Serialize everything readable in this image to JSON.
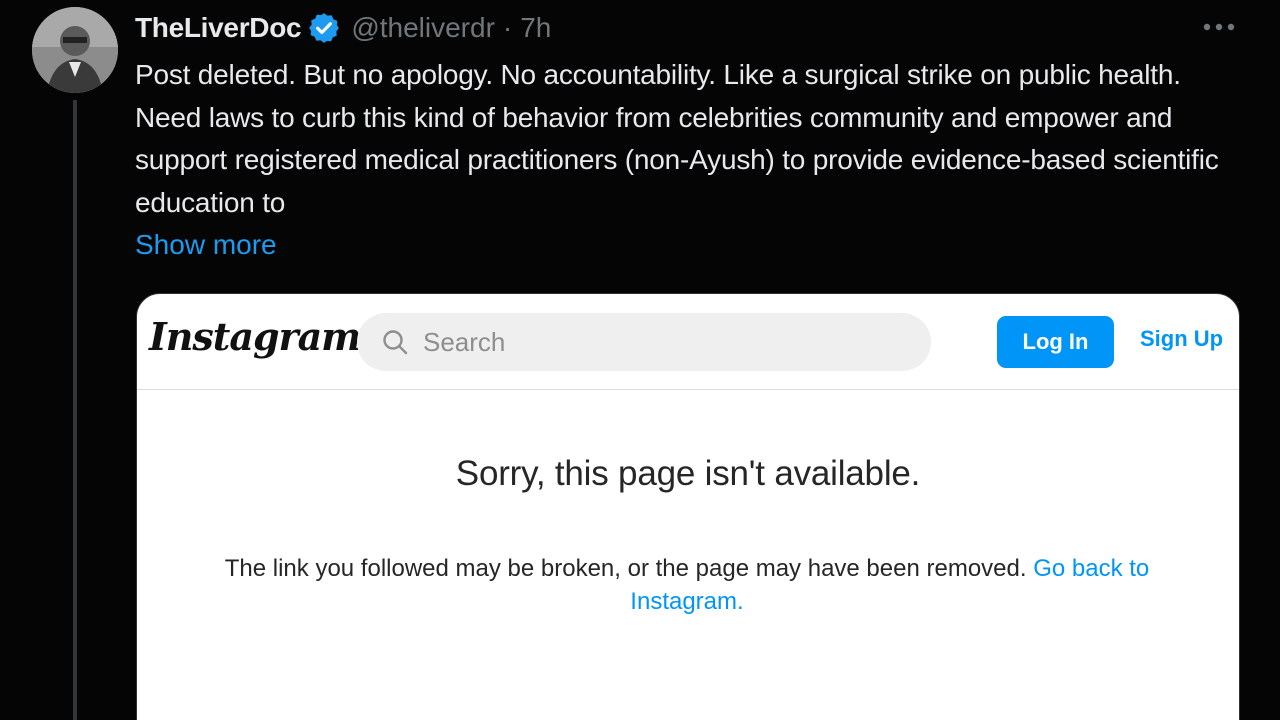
{
  "tweet": {
    "author": {
      "display_name": "TheLiverDoc",
      "handle": "@theliverdr",
      "verified": true
    },
    "separator": "·",
    "time": "7h",
    "body": "Post deleted. But no apology. No accountability. Like a surgical strike on public health. Need laws to curb this kind of behavior from celebrities community and empower and support registered medical practitioners (non-Ayush) to provide evidence-based scientific education to",
    "show_more_label": "Show more"
  },
  "embed": {
    "logo_text": "Instagram",
    "search": {
      "placeholder": "Search"
    },
    "login_label": "Log In",
    "signup_label": "Sign Up",
    "heading": "Sorry, this page isn't available.",
    "message": "The link you followed may be broken, or the page may have been removed.",
    "link_text": "Go back to Instagram."
  },
  "colors": {
    "background": "#050505",
    "text": "#e7e9ea",
    "muted": "#71767b",
    "twitter_blue": "#1d9bf0",
    "instagram_blue": "#0095f6"
  },
  "icons": {
    "verified": "verified-badge-icon",
    "more": "more-options-icon",
    "search": "search-icon"
  }
}
